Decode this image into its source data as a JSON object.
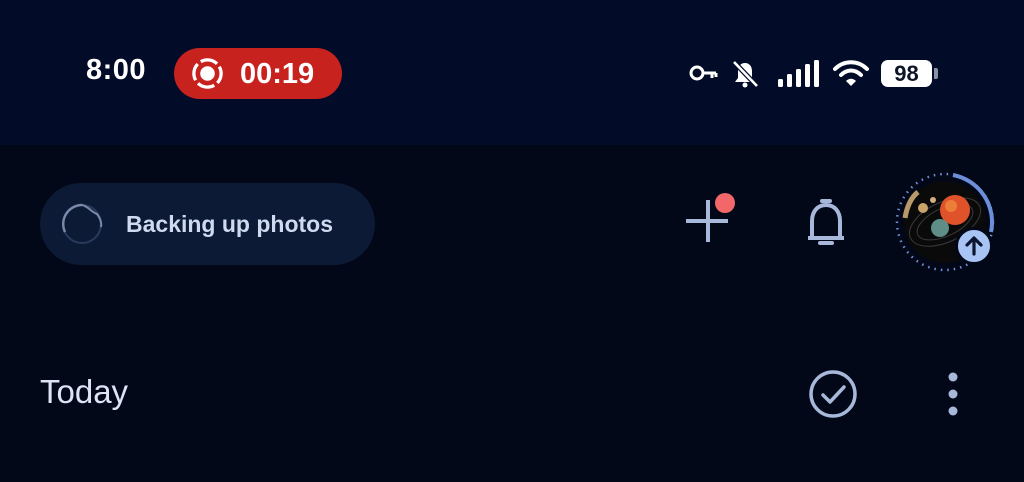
{
  "status_bar": {
    "time": "8:00",
    "recording_time": "00:19",
    "battery": "98",
    "icons": [
      "screen-record-icon",
      "vpn-key-icon",
      "mute-icon",
      "signal-icon",
      "wifi-icon",
      "battery-icon"
    ]
  },
  "app_bar": {
    "backup_label": "Backing up photos",
    "icons": [
      "backup-progress-icon",
      "add-icon",
      "notification-dot",
      "bell-icon",
      "avatar",
      "upload-icon"
    ],
    "colors": {
      "notification_dot": "#f2676a",
      "upload_badge": "#a8c4f5",
      "chip_background": "#0c1a35"
    }
  },
  "section": {
    "title": "Today",
    "icons": [
      "select-check-icon",
      "more-vert-icon"
    ]
  },
  "colors": {
    "background": "#030818",
    "status_bar": "#020c28",
    "recording_pill": "#c8221f"
  }
}
